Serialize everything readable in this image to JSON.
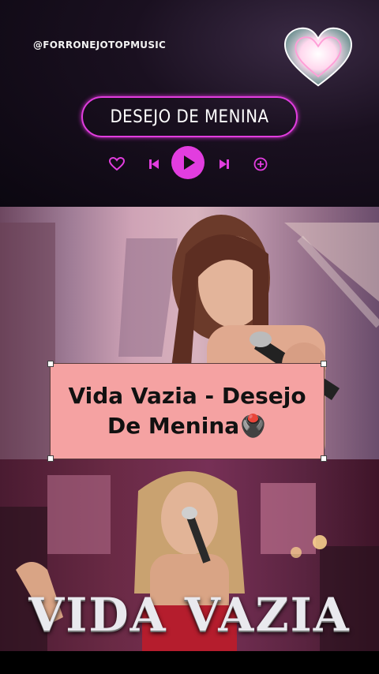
{
  "top": {
    "handle": "@FORRONEJOTOPMUSIC",
    "title": "DESEJO DE MENINA",
    "controls": [
      "heart-icon",
      "previous-icon",
      "play-icon",
      "next-icon",
      "add-icon"
    ],
    "accent": "#e23ddf"
  },
  "overlay": {
    "text": "Vida Vazia - Desejo De Menina",
    "emoji": "🖲️",
    "bg": "#f5a2a2"
  },
  "bottom": {
    "title": "VIDA VAZIA"
  }
}
